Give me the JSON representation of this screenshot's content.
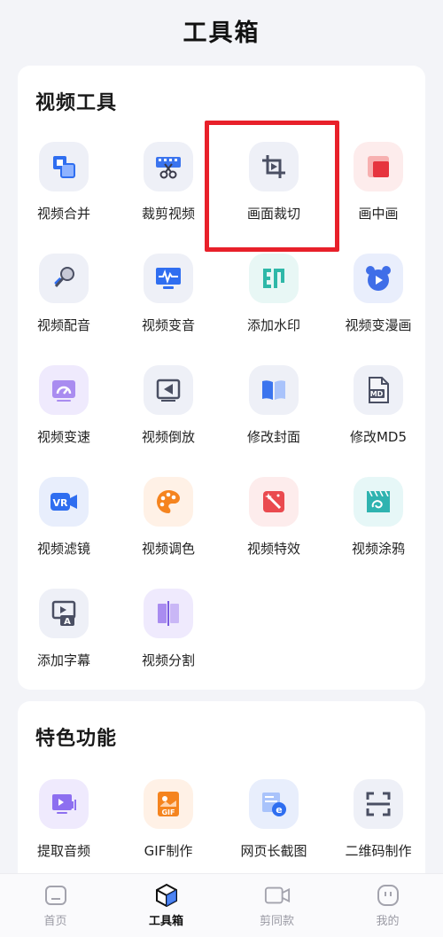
{
  "header": {
    "title": "工具箱"
  },
  "video_tools": {
    "title": "视频工具",
    "items": [
      {
        "label": "视频合并",
        "icon": "video-merge-icon"
      },
      {
        "label": "裁剪视频",
        "icon": "cut-video-icon"
      },
      {
        "label": "画面裁切",
        "icon": "crop-icon"
      },
      {
        "label": "画中画",
        "icon": "picture-in-picture-icon"
      },
      {
        "label": "视频配音",
        "icon": "microphone-icon"
      },
      {
        "label": "视频变音",
        "icon": "voice-change-icon"
      },
      {
        "label": "添加水印",
        "icon": "watermark-icon"
      },
      {
        "label": "视频变漫画",
        "icon": "cartoon-bear-icon"
      },
      {
        "label": "视频变速",
        "icon": "speed-gauge-icon"
      },
      {
        "label": "视频倒放",
        "icon": "reverse-play-icon"
      },
      {
        "label": "修改封面",
        "icon": "book-cover-icon"
      },
      {
        "label": "修改MD5",
        "icon": "md5-file-icon"
      },
      {
        "label": "视频滤镜",
        "icon": "vr-filter-icon"
      },
      {
        "label": "视频调色",
        "icon": "palette-icon"
      },
      {
        "label": "视频特效",
        "icon": "magic-wand-icon"
      },
      {
        "label": "视频涂鸦",
        "icon": "doodle-icon"
      },
      {
        "label": "添加字幕",
        "icon": "subtitle-icon"
      },
      {
        "label": "视频分割",
        "icon": "split-icon"
      }
    ]
  },
  "features": {
    "title": "特色功能",
    "items": [
      {
        "label": "提取音频",
        "icon": "extract-audio-icon"
      },
      {
        "label": "GIF制作",
        "icon": "gif-icon",
        "icon_text": "GIF"
      },
      {
        "label": "网页长截图",
        "icon": "webpage-screenshot-icon",
        "icon_text": "e"
      },
      {
        "label": "二维码制作",
        "icon": "qr-code-icon"
      }
    ]
  },
  "tabbar": {
    "items": [
      {
        "label": "首页",
        "icon": "home-icon",
        "active": false
      },
      {
        "label": "工具箱",
        "icon": "toolbox-icon",
        "active": true
      },
      {
        "label": "剪同款",
        "icon": "video-camera-icon",
        "active": false
      },
      {
        "label": "我的",
        "icon": "profile-face-icon",
        "active": false
      }
    ]
  },
  "colors": {
    "highlight_border": "#e8202a",
    "accent_blue": "#2f6ef0",
    "card_bg": "#ffffff",
    "page_bg": "#f3f4f8"
  }
}
